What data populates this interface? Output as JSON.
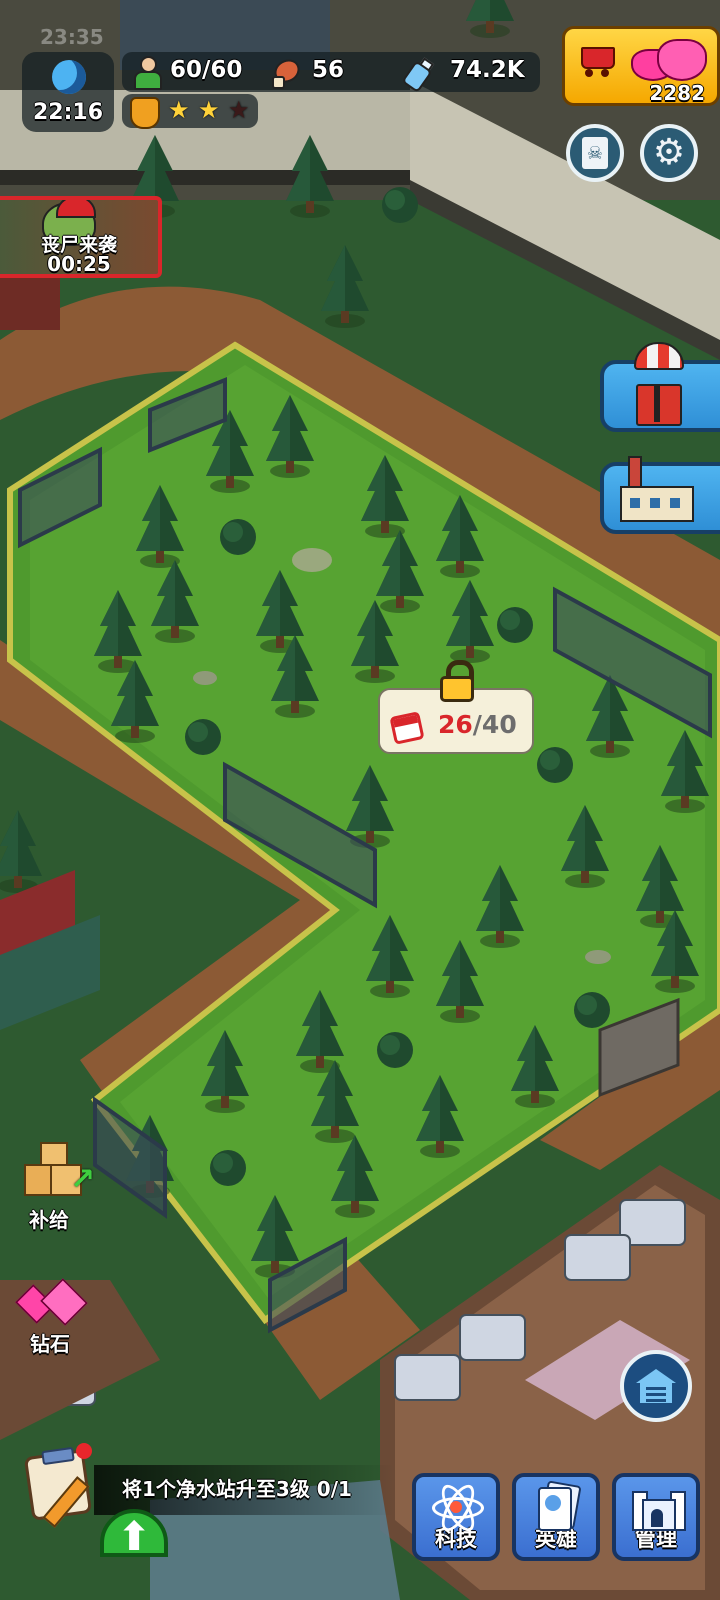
{
  "status_bar": {
    "time": "23:35"
  },
  "hud": {
    "clock": "22:16",
    "population": "60/60",
    "food": "56",
    "water": "74.2K",
    "gems": "2282",
    "rating_stars_filled": 2,
    "rating_stars_total": 3
  },
  "event": {
    "title": "丧尸来袭",
    "timer": "00:25"
  },
  "locked_area": {
    "current": "26",
    "total": "/40"
  },
  "left_buttons": {
    "supply": "补给",
    "diamond": "钻石"
  },
  "quest": {
    "text": "将1个净水站升至3级 0/1"
  },
  "bottom_nav": {
    "tech": "科技",
    "hero": "英雄",
    "manage": "管理"
  },
  "colors": {
    "grass": "#4f9a2e",
    "dirt": "#8c5a35",
    "hud_bg": "#141e23",
    "button_blue": "#3b6fd0",
    "gold": "#f5b800",
    "red_accent": "#d9262b"
  },
  "icons": [
    "moon-icon",
    "survivor-icon",
    "meat-icon",
    "water-bottle-icon",
    "shop-cart-icon",
    "gem-icon",
    "skull-book-icon",
    "gear-icon",
    "airdrop-icon",
    "factory-icon",
    "lock-icon",
    "calendar-icon",
    "supply-boxes-icon",
    "diamond-icon",
    "notepad-icon",
    "arrow-up-icon",
    "atom-icon",
    "hero-card-icon",
    "castle-icon",
    "warehouse-icon"
  ]
}
